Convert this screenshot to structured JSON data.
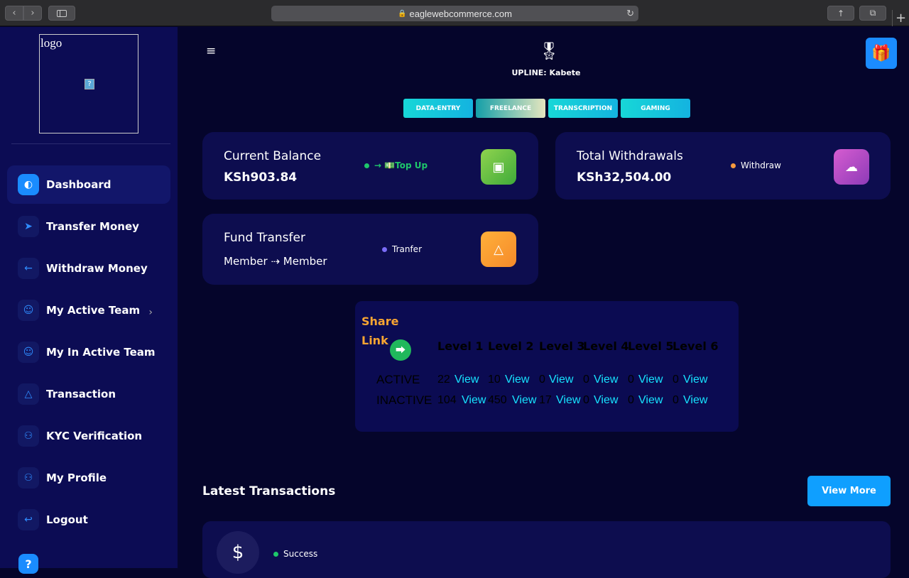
{
  "browser": {
    "url": "eaglewebcommerce.com"
  },
  "sidebar": {
    "logo_alt": "logo",
    "items": [
      {
        "label": "Dashboard",
        "icon": "palette-icon",
        "active": true
      },
      {
        "label": "Transfer Money",
        "icon": "send-icon"
      },
      {
        "label": "Withdraw Money",
        "icon": "arrow-left-circle-icon"
      },
      {
        "label": "My Active Team",
        "icon": "team-icon",
        "has_submenu": true
      },
      {
        "label": "My In Active Team",
        "icon": "team-icon",
        "has_submenu": true
      },
      {
        "label": "Transaction",
        "icon": "recycle-icon"
      },
      {
        "label": "KYC Verification",
        "icon": "user-check-icon"
      },
      {
        "label": "My Profile",
        "icon": "user-icon"
      },
      {
        "label": "Logout",
        "icon": "logout-icon"
      }
    ]
  },
  "header": {
    "upline": "UPLINE: Kabete",
    "tabs": [
      "DATA-ENTRY",
      "FREELANCE",
      "TRANSCRIPTION",
      "GAMING"
    ],
    "active_tab": "FREELANCE"
  },
  "cards": {
    "balance": {
      "title": "Current Balance",
      "value": "KSh903.84",
      "action": "→ 💵Top Up",
      "dot_color": "#1ec76b"
    },
    "withdrawals": {
      "title": "Total Withdrawals",
      "value": "KSh32,504.00",
      "action": "Withdraw",
      "dot_color": "#f79a3e"
    },
    "fund": {
      "title": "Fund Transfer",
      "value": "Member ⇢ Member",
      "action": "Tranfer",
      "dot_color": "#7a6cf7"
    }
  },
  "share": {
    "share_label": "Share",
    "link_label": "Link",
    "levels": [
      "Level 1",
      "Level 2",
      "Level 3",
      "Level 4",
      "Level 5",
      "Level 6"
    ],
    "view_label": "View",
    "rows": [
      {
        "label": "ACTIVE",
        "counts": [
          "22",
          "10",
          "0",
          "0",
          "0",
          "0"
        ]
      },
      {
        "label": "INACTIVE",
        "counts": [
          "104",
          "450",
          "17",
          "0",
          "0",
          "0"
        ]
      }
    ]
  },
  "transactions": {
    "title": "Latest Transactions",
    "view_more": "View More",
    "items": [
      {
        "status": "Success",
        "icon": "dollar-icon"
      }
    ]
  },
  "colors": {
    "accent": "#0f9fff",
    "sidebar_bg": "#0c0c54",
    "page_bg": "#05052b"
  }
}
